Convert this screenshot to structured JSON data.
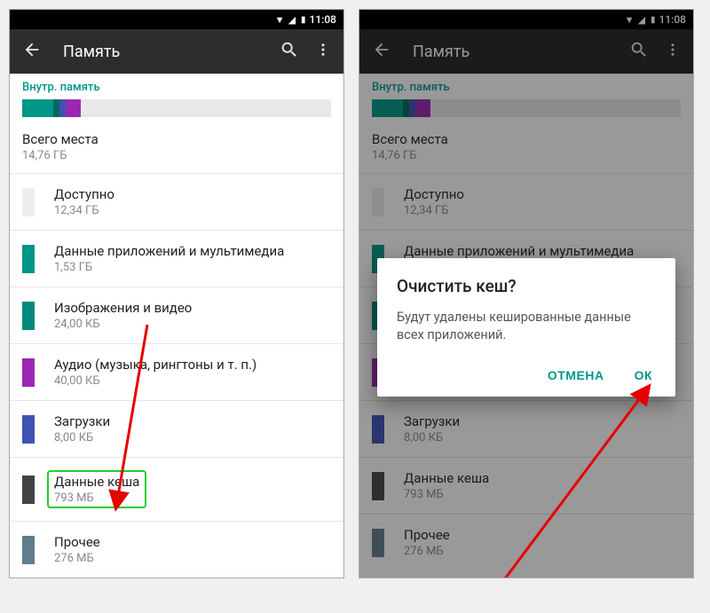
{
  "status": {
    "time": "11:08"
  },
  "appbar": {
    "title": "Память"
  },
  "storage": {
    "section_label": "Внутр. память",
    "total_label": "Всего места",
    "total_value": "14,76 ГБ",
    "segments": [
      {
        "color": "#009688",
        "pct": 10
      },
      {
        "color": "#00695c",
        "pct": 2
      },
      {
        "color": "#3f51b5",
        "pct": 2
      },
      {
        "color": "#9c27b0",
        "pct": 5
      },
      {
        "color": "#e8e8e8",
        "pct": 81
      }
    ],
    "items": [
      {
        "color": "#eeeeee",
        "title": "Доступно",
        "sub": "12,34 ГБ"
      },
      {
        "color": "#009688",
        "title": "Данные приложений и мультимедиа",
        "sub": "1,53 ГБ"
      },
      {
        "color": "#00897b",
        "title": "Изображения и видео",
        "sub": "24,00 КБ"
      },
      {
        "color": "#9c27b0",
        "title": "Аудио (музыка, рингтоны и т. п.)",
        "sub": "40,00 КБ"
      },
      {
        "color": "#3f51b5",
        "title": "Загрузки",
        "sub": "8,00 КБ"
      },
      {
        "color": "#424242",
        "title": "Данные кеша",
        "sub": "793 МБ",
        "highlight": true
      },
      {
        "color": "#607d8b",
        "title": "Прочее",
        "sub": "276 МБ"
      }
    ]
  },
  "dialog": {
    "title": "Очистить кеш?",
    "message": "Будут удалены кешированные данные всех приложений.",
    "cancel": "ОТМЕНА",
    "ok": "ОК"
  }
}
